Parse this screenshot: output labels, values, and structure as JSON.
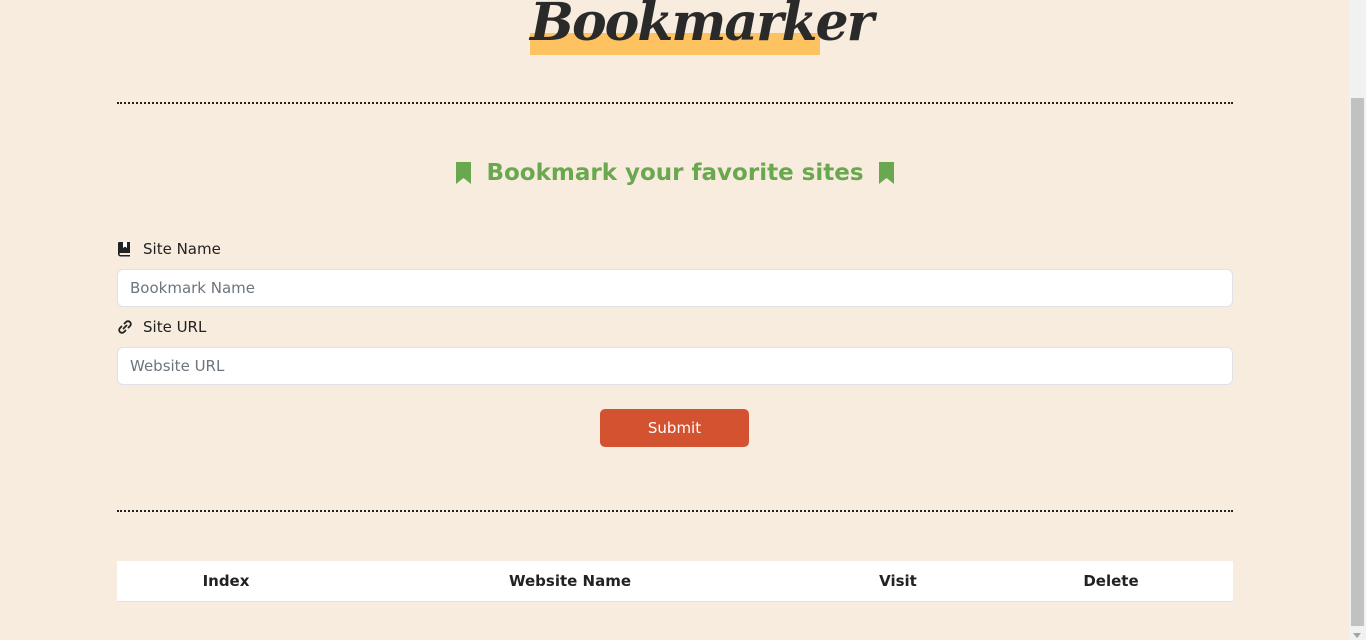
{
  "logo": {
    "text": "Bookmarker",
    "highlight_color": "#fec260"
  },
  "heading": {
    "text": "Bookmark your favorite sites",
    "icon": "bookmark-icon",
    "color": "#6aa84f"
  },
  "form": {
    "site_name": {
      "label": "Site Name",
      "icon": "book-bookmark-icon",
      "placeholder": "Bookmark Name",
      "value": ""
    },
    "site_url": {
      "label": "Site URL",
      "icon": "link-icon",
      "placeholder": "Website URL",
      "value": ""
    },
    "submit_label": "Submit",
    "submit_color": "#d35230"
  },
  "table": {
    "columns": [
      "Index",
      "Website Name",
      "Visit",
      "Delete"
    ],
    "rows": []
  },
  "colors": {
    "background": "#f8ecdf"
  }
}
